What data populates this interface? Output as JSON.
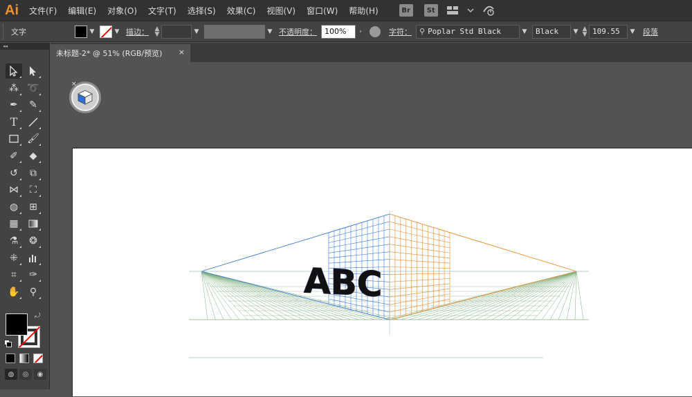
{
  "menubar": {
    "logo": "Ai",
    "items": [
      "文件(F)",
      "编辑(E)",
      "对象(O)",
      "文字(T)",
      "选择(S)",
      "效果(C)",
      "视图(V)",
      "窗口(W)",
      "帮助(H)"
    ],
    "bridge": "Br",
    "stock": "St"
  },
  "controlbar": {
    "mode_label": "文字",
    "stroke_label": "描边：",
    "opacity_label": "不透明度：",
    "opacity_value": "100%",
    "char_label": "字符：",
    "font_family": "Poplar Std Black",
    "font_style": "Black",
    "font_size": "109.55",
    "paragraph_label": "段落"
  },
  "document": {
    "tab_title": "未标题-2* @ 51% (RGB/预览)",
    "close": "×"
  },
  "artwork": {
    "text": "ABC",
    "left_plane_color": "#3a76d8",
    "right_plane_color": "#f08c2a",
    "ground_color": "#7fb07f",
    "horizon_color": "#9fbfbf"
  },
  "tools": [
    "selection-icon",
    "direct-selection-icon",
    "magic-wand-icon",
    "lasso-icon",
    "pen-icon",
    "curvature-icon",
    "type-icon",
    "line-icon",
    "rectangle-icon",
    "paintbrush-icon",
    "shaper-icon",
    "eraser-icon",
    "rotate-icon",
    "scale-icon",
    "width-icon",
    "free-transform-icon",
    "shape-builder-icon",
    "perspective-grid-icon",
    "mesh-icon",
    "gradient-icon",
    "eyedropper-icon",
    "blend-icon",
    "symbol-sprayer-icon",
    "column-graph-icon",
    "artboard-icon",
    "slice-icon",
    "hand-icon",
    "zoom-icon"
  ]
}
